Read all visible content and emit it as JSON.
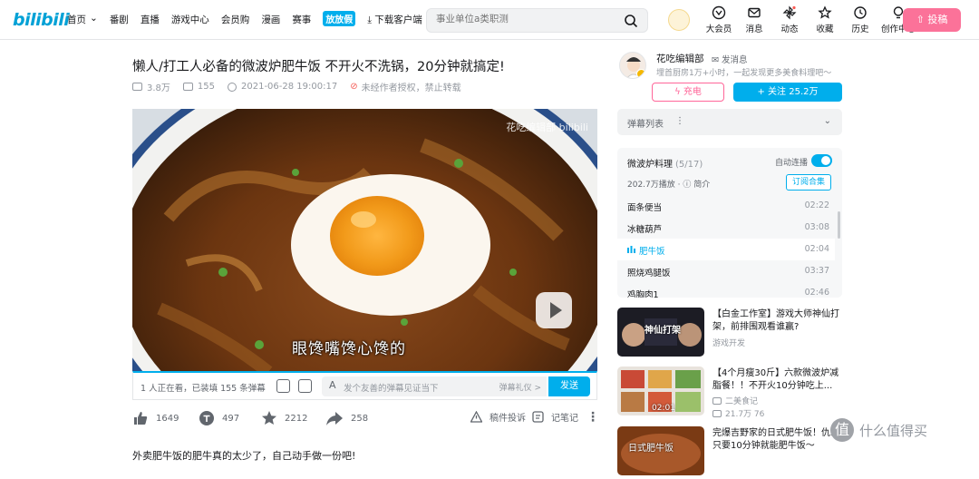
{
  "header": {
    "logo": "bilibili",
    "nav": [
      "首页",
      "番剧",
      "直播",
      "游戏中心",
      "会员购",
      "漫画",
      "赛事"
    ],
    "promo": "放放假",
    "download": "下载客户端",
    "download_badge": "新",
    "search_placeholder": "事业单位a类职测",
    "right_nav": [
      "大会员",
      "消息",
      "动态",
      "收藏",
      "历史",
      "创作中心"
    ],
    "upload": "投稿"
  },
  "video": {
    "title": "懒人/打工人必备的微波炉肥牛饭 不开火不洗锅，20分钟就搞定!",
    "views": "3.8万",
    "danmaku": "155",
    "date": "2021-06-28 19:00:17",
    "notice": "未经作者授权，禁止转载",
    "watermark": "花吃编辑部 bilibili",
    "subtitle": "眼馋嘴馋心馋的",
    "watching": "1 人正在看，已装填 155 条弹幕",
    "danmaku_placeholder": "发个友善的弹幕见证当下",
    "etiquette": "弹幕礼仪 >",
    "send": "发送",
    "likes": "1649",
    "coins": "497",
    "favorites": "2212",
    "shares": "258",
    "report": "稿件投诉",
    "notes": "记笔记",
    "description": "外卖肥牛饭的肥牛真的太少了，自己动手做一份吧!"
  },
  "author": {
    "name": "花吃编辑部",
    "message": "发消息",
    "desc": "埋首厨房1万+小时，一起发现更多美食料理吧～",
    "charge": "充电",
    "follow": "+ 关注 25.2万"
  },
  "danmaku_list": "弹幕列表",
  "playlist": {
    "title": "微波炉料理",
    "count": "(5/17)",
    "autoplay": "自动连播",
    "plays": "202.7万播放",
    "intro": "简介",
    "subscribe": "订阅合集",
    "episodes": [
      {
        "name": "面条便当",
        "dur": "02:22"
      },
      {
        "name": "冰糖葫芦",
        "dur": "03:08"
      },
      {
        "name": "肥牛饭",
        "dur": "02:04"
      },
      {
        "name": "照烧鸡腿饭",
        "dur": "03:37"
      },
      {
        "name": "鸡胸肉1",
        "dur": "02:46"
      }
    ]
  },
  "recommendations": [
    {
      "title": "【白金工作室】游戏大师神仙打架，前排围观看谁赢?",
      "up": "游戏开发",
      "stats": "",
      "thumb_text": "神仙打架"
    },
    {
      "title": "【4个月瘦30斤】六款微波炉减脂餐！！不开火10分钟吃上...",
      "up": "二美食记",
      "stats": "21.7万  76",
      "duration": "02:01"
    },
    {
      "title": "完爆吉野家的日式肥牛饭！仇家只要10分钟就能肥牛饭～",
      "up": "",
      "stats": "",
      "thumb_text": "日式肥牛饭"
    }
  ],
  "footer_brand": "什么值得买",
  "colors": {
    "accent": "#00aeec",
    "pink": "#fb7299"
  }
}
